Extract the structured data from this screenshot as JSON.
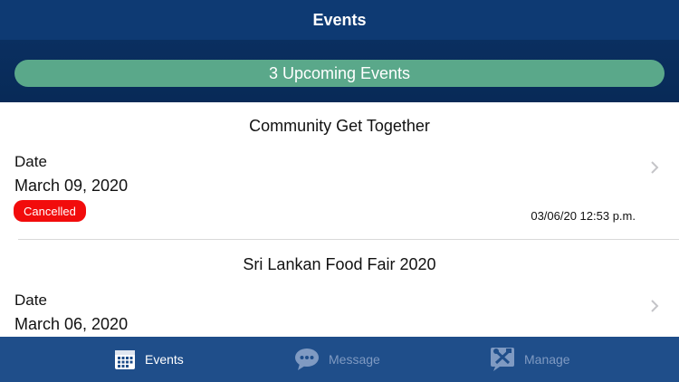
{
  "header": {
    "title": "Events"
  },
  "banner": {
    "label": "3 Upcoming Events"
  },
  "events": [
    {
      "title": "Community Get Together",
      "date_label": "Date",
      "date": "March 09, 2020",
      "status": "Cancelled",
      "updated": "03/06/20 12:53 p.m."
    },
    {
      "title": "Sri Lankan Food Fair 2020",
      "date_label": "Date",
      "date": "March 06, 2020"
    }
  ],
  "tabs": [
    {
      "label": "Events",
      "icon": "calendar-icon",
      "active": true
    },
    {
      "label": "Message",
      "icon": "chat-bubble-icon",
      "active": false
    },
    {
      "label": "Manage",
      "icon": "tools-icon",
      "active": false
    }
  ],
  "colors": {
    "nav": "#0e3a73",
    "banner": "#5aa88a",
    "cancel": "#f20c0c",
    "tabbar": "#1f4e8a"
  }
}
